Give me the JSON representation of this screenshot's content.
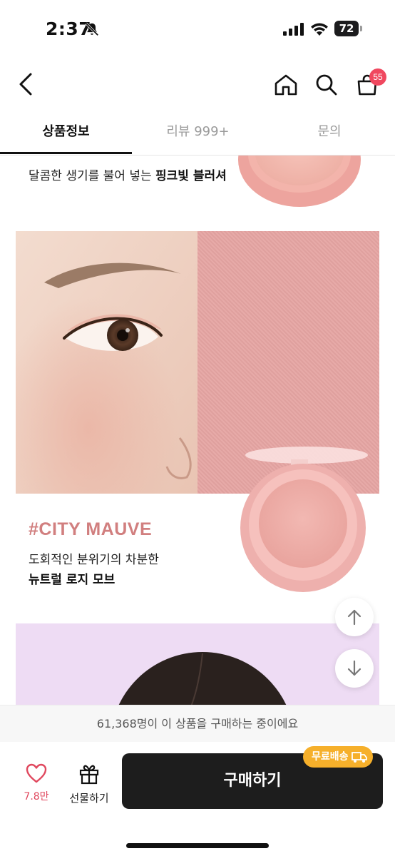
{
  "status_bar": {
    "time": "2:37",
    "battery": "72"
  },
  "nav": {
    "cart_count": "55"
  },
  "tabs": [
    {
      "label": "상품정보",
      "active": true
    },
    {
      "label": "리뷰 999+",
      "active": false
    },
    {
      "label": "문의",
      "active": false
    }
  ],
  "content": {
    "top_line_normal": "달콤한 생기를 불어 넣는 ",
    "top_line_bold": "핑크빛 블러셔",
    "shade_title": "#CITY MAUVE",
    "shade_desc": "도회적인 분위기의 차분한",
    "shade_name": "뉴트럴 로지 모브"
  },
  "purchase_notice": "61,368명이 이 상품을 구매하는 중이에요",
  "actions": {
    "like_count": "7.8만",
    "gift_label": "선물하기",
    "buy_label": "구매하기",
    "free_shipping": "무료배송"
  },
  "colors": {
    "accent_pink": "#e0485e",
    "badge_orange": "#f6b02b",
    "shade_text": "#d17f7f",
    "buy_button": "#1d1d1d"
  }
}
